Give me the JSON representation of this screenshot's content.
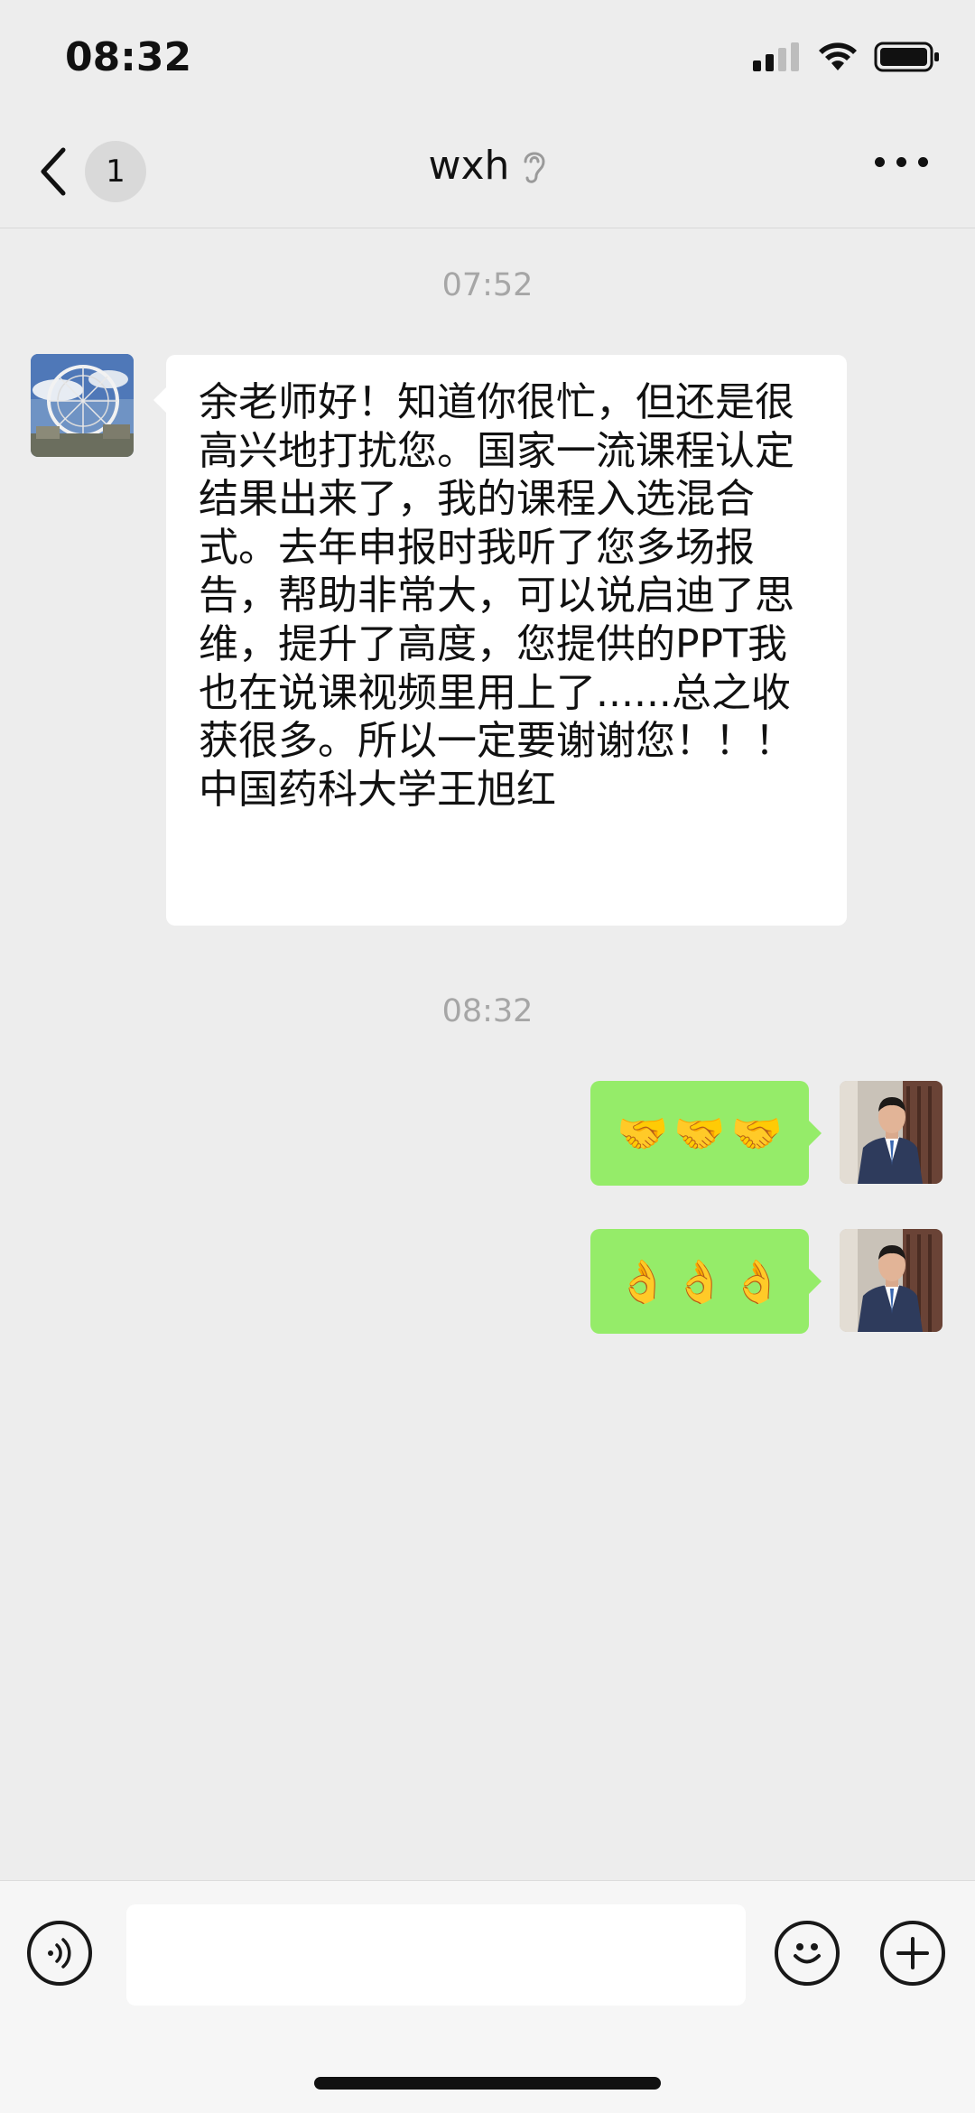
{
  "status_bar": {
    "time": "08:32"
  },
  "header": {
    "back_badge": "1",
    "title": "wxh"
  },
  "messages": [
    {
      "type": "timestamp",
      "text": "07:52"
    },
    {
      "type": "received",
      "sender_avatar": "ferris-wheel-avatar",
      "text": "余老师好！知道你很忙，但还是很高兴地打扰您。国家一流课程认定结果出来了，我的课程入选混合式。去年申报时我听了您多场报告，帮助非常大，可以说启迪了思维，提升了高度，您提供的PPT我也在说课视频里用上了......总之收获很多。所以一定要谢谢您！！！\n中国药科大学王旭红"
    },
    {
      "type": "timestamp",
      "text": "08:32"
    },
    {
      "type": "sent",
      "emoji": [
        "🤝",
        "🤝",
        "🤝"
      ],
      "emoji_name": "handshake"
    },
    {
      "type": "sent",
      "emoji": [
        "👌",
        "👌",
        "👌"
      ],
      "emoji_name": "ok-hand"
    }
  ],
  "input_bar": {
    "placeholder": "",
    "value": ""
  },
  "colors": {
    "background": "#ededed",
    "sent_bubble": "#95ec69",
    "received_bubble": "#ffffff",
    "timestamp": "#a6a6a6"
  }
}
